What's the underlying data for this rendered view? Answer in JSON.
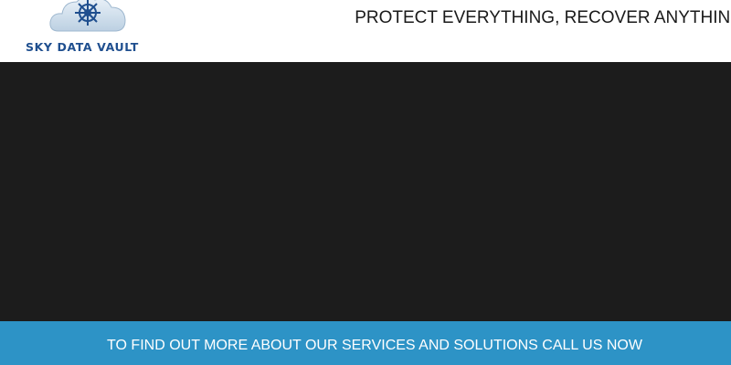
{
  "header": {
    "logo": {
      "name": "SKY DATA VAULT",
      "icon": "cloud-ship-wheel-icon"
    },
    "tagline": "PROTECT EVERYTHING, RECOVER ANYTHING"
  },
  "video": {
    "state": "blank"
  },
  "cta": {
    "text": "TO FIND OUT MORE ABOUT OUR SERVICES AND SOLUTIONS CALL US NOW"
  },
  "colors": {
    "brand_blue": "#1f4f8f",
    "cta_background": "#2d93c6",
    "video_background": "#1c1c1c",
    "tagline_text": "#1a1a1a"
  }
}
